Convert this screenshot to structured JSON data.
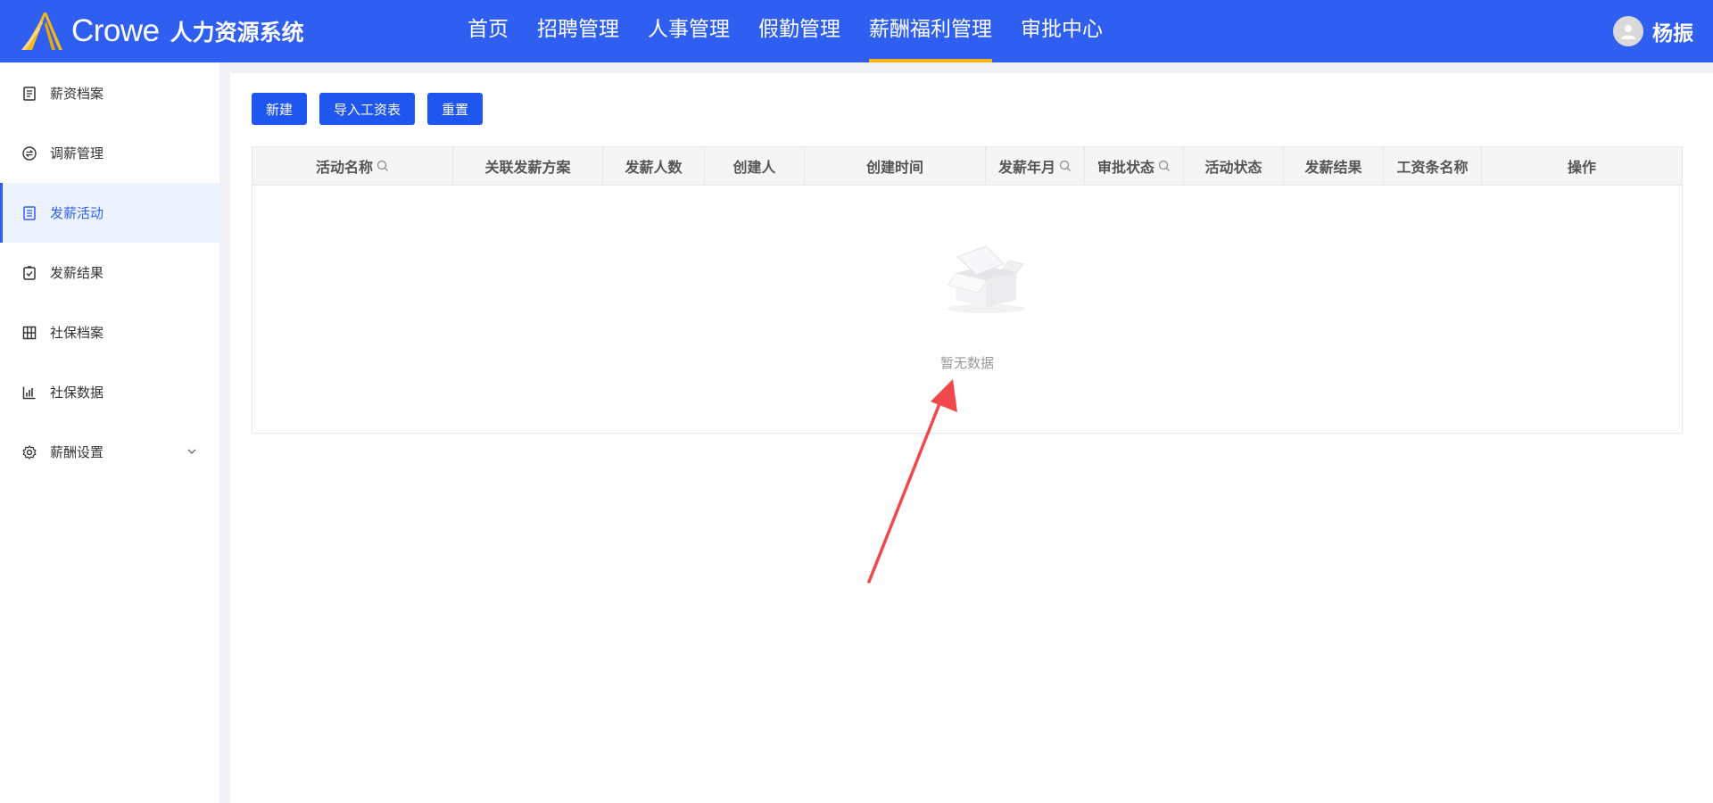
{
  "app": {
    "brand": "Crowe",
    "system_name": "人力资源系统"
  },
  "topnav": {
    "items": [
      {
        "label": "首页",
        "active": false
      },
      {
        "label": "招聘管理",
        "active": false
      },
      {
        "label": "人事管理",
        "active": false
      },
      {
        "label": "假勤管理",
        "active": false
      },
      {
        "label": "薪酬福利管理",
        "active": true
      },
      {
        "label": "审批中心",
        "active": false
      }
    ]
  },
  "user": {
    "name": "杨振",
    "icon": "user-avatar-icon"
  },
  "sidebar": {
    "items": [
      {
        "label": "薪资档案",
        "icon": "document-icon",
        "active": false
      },
      {
        "label": "调薪管理",
        "icon": "exchange-icon",
        "active": false
      },
      {
        "label": "发薪活动",
        "icon": "list-doc-icon",
        "active": true
      },
      {
        "label": "发薪结果",
        "icon": "check-clipboard-icon",
        "active": false
      },
      {
        "label": "社保档案",
        "icon": "grid-icon",
        "active": false
      },
      {
        "label": "社保数据",
        "icon": "bar-chart-icon",
        "active": false
      },
      {
        "label": "薪酬设置",
        "icon": "gear-icon",
        "active": false,
        "expandable": true
      }
    ]
  },
  "toolbar": {
    "new_label": "新建",
    "import_label": "导入工资表",
    "reset_label": "重置"
  },
  "table": {
    "columns": [
      {
        "label": "活动名称",
        "searchable": true
      },
      {
        "label": "关联发薪方案",
        "searchable": false
      },
      {
        "label": "发薪人数",
        "searchable": false
      },
      {
        "label": "创建人",
        "searchable": false
      },
      {
        "label": "创建时间",
        "searchable": false
      },
      {
        "label": "发薪年月",
        "searchable": true
      },
      {
        "label": "审批状态",
        "searchable": true
      },
      {
        "label": "活动状态",
        "searchable": false
      },
      {
        "label": "发薪结果",
        "searchable": false
      },
      {
        "label": "工资条名称",
        "searchable": false
      },
      {
        "label": "操作",
        "searchable": false
      }
    ],
    "rows": [],
    "empty_text": "暂无数据"
  },
  "colors": {
    "primary": "#2f5ff0",
    "button": "#1f56f0",
    "nav_active_underline": "#f5b41a",
    "annotation_arrow": "#f0484b"
  }
}
